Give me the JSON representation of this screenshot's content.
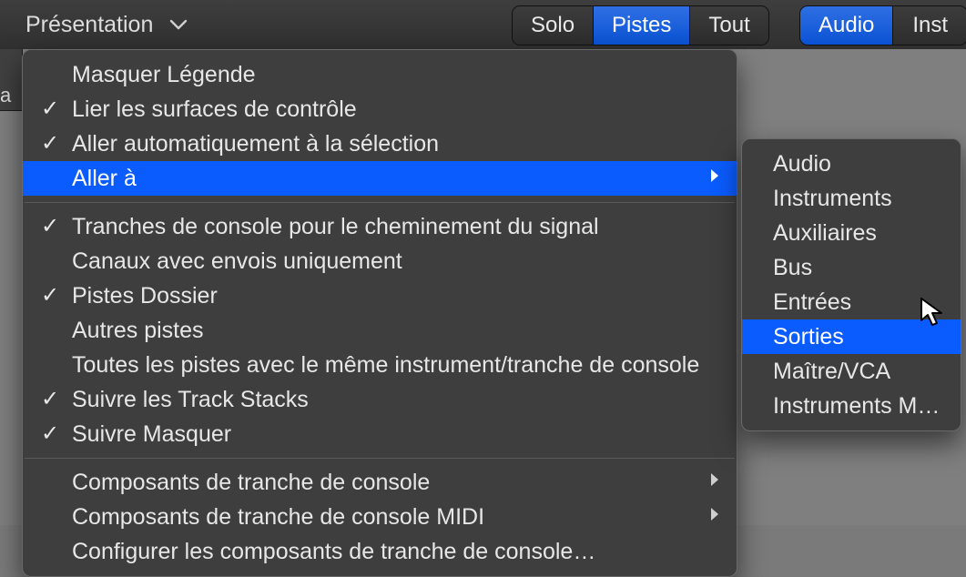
{
  "toolbar": {
    "presentation_label": "Présentation",
    "seg1": {
      "solo": "Solo",
      "pistes": "Pistes",
      "tout": "Tout"
    },
    "seg2": {
      "audio": "Audio",
      "inst": "Inst"
    }
  },
  "left_strip_label": "a",
  "menu": {
    "s1": [
      {
        "label": "Masquer Légende",
        "checked": false
      },
      {
        "label": "Lier les surfaces de contrôle",
        "checked": true
      },
      {
        "label": "Aller automatiquement à la sélection",
        "checked": true
      },
      {
        "label": "Aller à",
        "checked": false,
        "submenu": true,
        "hi": true
      }
    ],
    "s2": [
      {
        "label": "Tranches de console pour le cheminement du signal",
        "checked": true
      },
      {
        "label": "Canaux avec envois uniquement",
        "checked": false
      },
      {
        "label": "Pistes Dossier",
        "checked": true
      },
      {
        "label": "Autres pistes",
        "checked": false
      },
      {
        "label": "Toutes les pistes avec le même instrument/tranche de console",
        "checked": false
      },
      {
        "label": "Suivre les Track Stacks",
        "checked": true
      },
      {
        "label": "Suivre Masquer",
        "checked": true
      }
    ],
    "s3": [
      {
        "label": "Composants de tranche de console",
        "submenu": true
      },
      {
        "label": "Composants de tranche de console MIDI",
        "submenu": true
      },
      {
        "label": "Configurer les composants de tranche de console…"
      }
    ]
  },
  "submenu": [
    {
      "label": "Audio"
    },
    {
      "label": "Instruments"
    },
    {
      "label": "Auxiliaires"
    },
    {
      "label": "Bus"
    },
    {
      "label": "Entrées"
    },
    {
      "label": "Sorties",
      "hi": true
    },
    {
      "label": "Maître/VCA"
    },
    {
      "label": "Instruments MIDI"
    }
  ]
}
